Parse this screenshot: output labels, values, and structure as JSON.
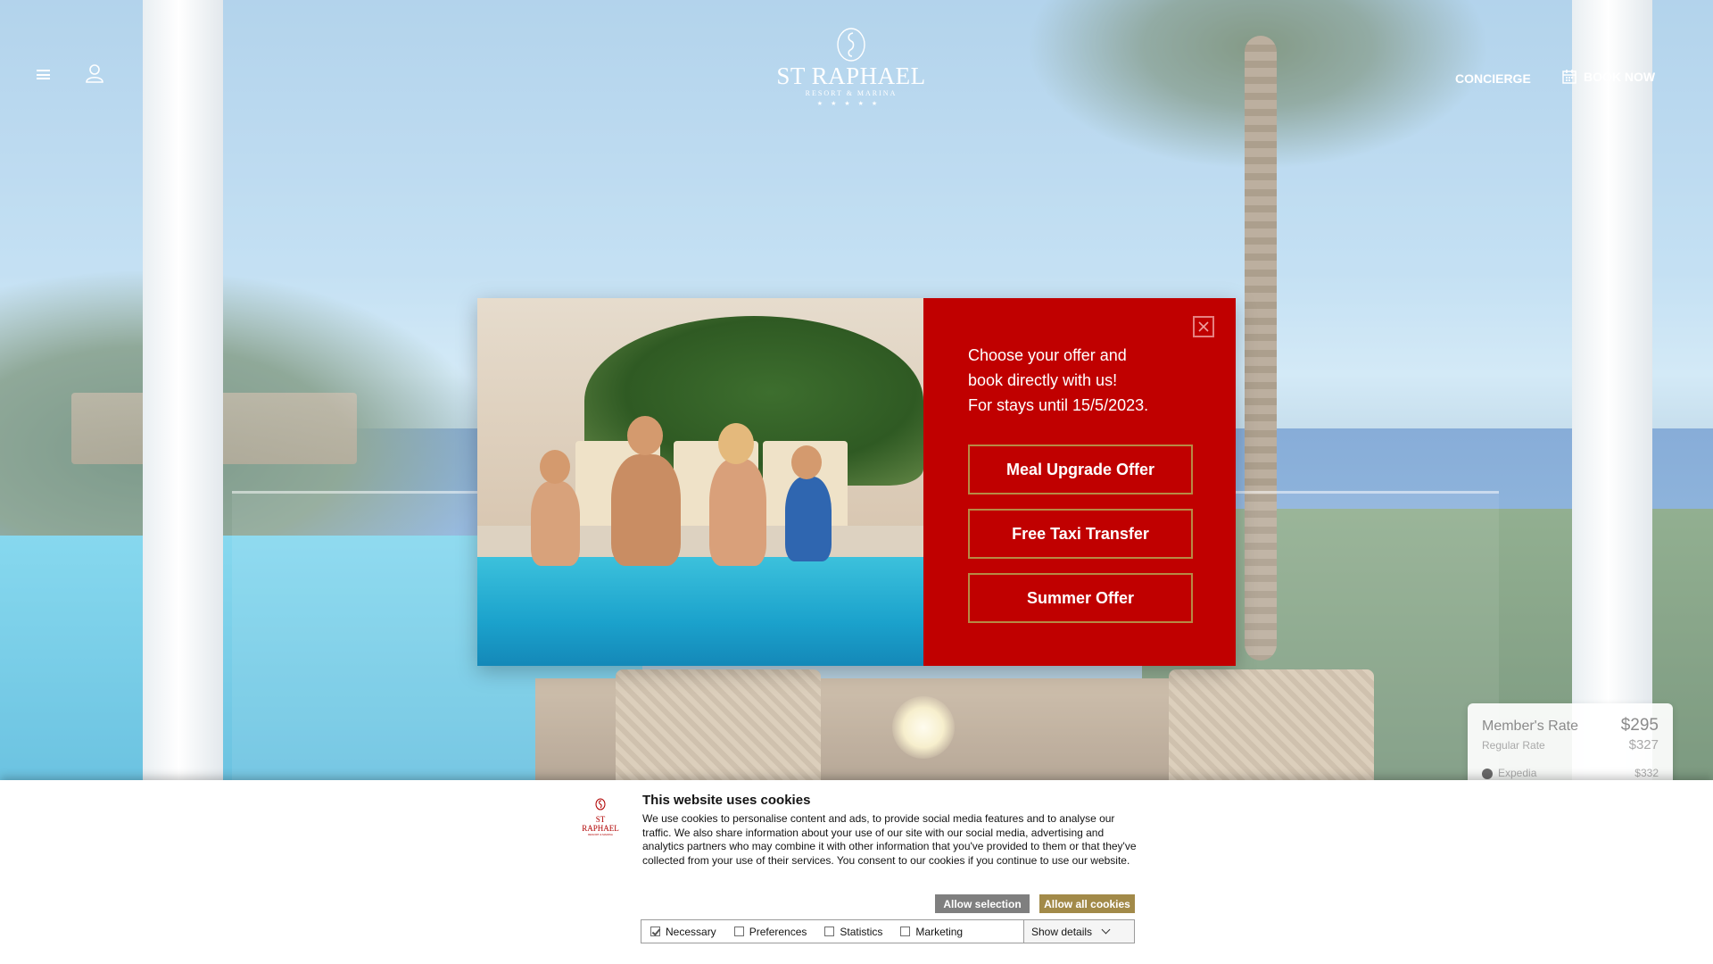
{
  "header": {
    "logo": {
      "name": "ST RAPHAEL",
      "subtitle": "RESORT & MARINA",
      "stars": "★★★★★"
    },
    "concierge_label": "CONCIERGE",
    "book_now_label": "BOOK NOW"
  },
  "rate_widget": {
    "member_label": "Member's Rate",
    "member_price": "$295",
    "regular_label": "Regular Rate",
    "regular_price": "$327",
    "third_label": "Expedia",
    "third_price": "$332"
  },
  "popup": {
    "text_line1": "Choose your offer and",
    "text_line2": "book directly with us!",
    "text_line3": "For stays until 15/5/2023.",
    "offers": [
      "Meal Upgrade Offer",
      "Free Taxi Transfer",
      "Summer Offer"
    ],
    "panel_color": "#c00000",
    "border_color": "#b78a45"
  },
  "cookie_banner": {
    "logo_name": "ST RAPHAEL",
    "logo_sub": "RESORT & MARINA",
    "title": "This website uses cookies",
    "description": "We use cookies to personalise content and ads, to provide social media features and to analyse our traffic. We also share information about your use of our site with our social media, advertising and analytics partners who may combine it with other information that you've provided to them or that they've collected from your use of their services. You consent to our cookies if you continue to use our website.",
    "allow_selection_label": "Allow selection",
    "allow_all_label": "Allow all cookies",
    "options": [
      {
        "label": "Necessary",
        "checked": true
      },
      {
        "label": "Preferences",
        "checked": false
      },
      {
        "label": "Statistics",
        "checked": false
      },
      {
        "label": "Marketing",
        "checked": false
      }
    ],
    "show_details_label": "Show details"
  }
}
